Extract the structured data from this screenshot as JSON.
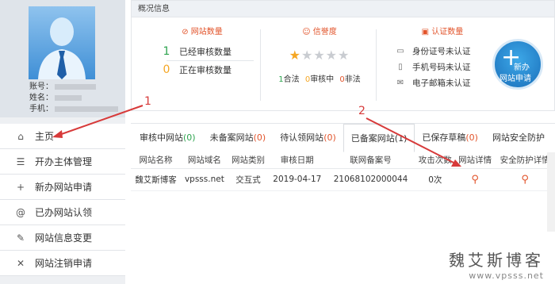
{
  "profile": {
    "account_label": "账号：",
    "name_label": "姓名：",
    "phone_label": "手机："
  },
  "nav": [
    {
      "label": "主页",
      "icon": "home-icon",
      "glyph": "⌂"
    },
    {
      "label": "开办主体管理",
      "icon": "list-icon",
      "glyph": "☰"
    },
    {
      "label": "新办网站申请",
      "icon": "plus-icon",
      "glyph": "+"
    },
    {
      "label": "已办网站认领",
      "icon": "at-icon",
      "glyph": "@"
    },
    {
      "label": "网站信息变更",
      "icon": "edit-icon",
      "glyph": "✎"
    },
    {
      "label": "网站注销申请",
      "icon": "close-icon",
      "glyph": "✕"
    }
  ],
  "overview": {
    "title": "概况信息",
    "site_count": {
      "heading": "网站数量",
      "rows": [
        {
          "num": "1",
          "label": "已经审核数量",
          "color": "#2ea44f"
        },
        {
          "num": "0",
          "label": "正在审核数量",
          "color": "#f5a623"
        }
      ]
    },
    "credit": {
      "heading": "信誉度",
      "stars_on": 1,
      "stars_total": 5,
      "stats": [
        {
          "num": "1",
          "label": "合法",
          "color": "#2ea44f"
        },
        {
          "num": "0",
          "label": "审核中",
          "color": "#f5a623"
        },
        {
          "num": "0",
          "label": "非法",
          "color": "#e2542b"
        }
      ]
    },
    "auth": {
      "heading": "认证数量",
      "rows": [
        {
          "label": "身份证号未认证",
          "icon": "id-card-icon",
          "glyph": "▭"
        },
        {
          "label": "手机号码未认证",
          "icon": "phone-icon",
          "glyph": "▯"
        },
        {
          "label": "电子邮箱未认证",
          "icon": "mail-icon",
          "glyph": "✉"
        }
      ]
    },
    "new_button": {
      "line1": "新办",
      "line2": "网站申请"
    }
  },
  "tabs": [
    {
      "text": "审核中网站",
      "count": "(0)",
      "count_class": "c"
    },
    {
      "text": "未备案网站",
      "count": "(0)",
      "count_class": "o"
    },
    {
      "text": "待认领网站",
      "count": "(0)",
      "count_class": "r"
    },
    {
      "text": "已备案网站(1)",
      "count": "",
      "count_class": ""
    },
    {
      "text": "已保存草稿",
      "count": "(0)",
      "count_class": "o"
    },
    {
      "text": "网站安全防护",
      "count": "",
      "count_class": ""
    }
  ],
  "table": {
    "headers": [
      "网站名称",
      "网站域名",
      "网站类别",
      "审核日期",
      "联网备案号",
      "攻击次数",
      "网站详情",
      "安全防护详情"
    ],
    "rows": [
      [
        "魏艾斯博客",
        "vpsss.net",
        "交互式",
        "2019-04-17",
        "21068102000044",
        "0次"
      ]
    ]
  },
  "annotations": {
    "one": "1",
    "two": "2"
  },
  "watermark": {
    "cn": "魏艾斯博客",
    "en": "www.vpsss.net"
  },
  "colors": {
    "accent": "#e2542b",
    "green": "#2ea44f",
    "orange": "#f5a623",
    "blue": "#1a6fba"
  }
}
